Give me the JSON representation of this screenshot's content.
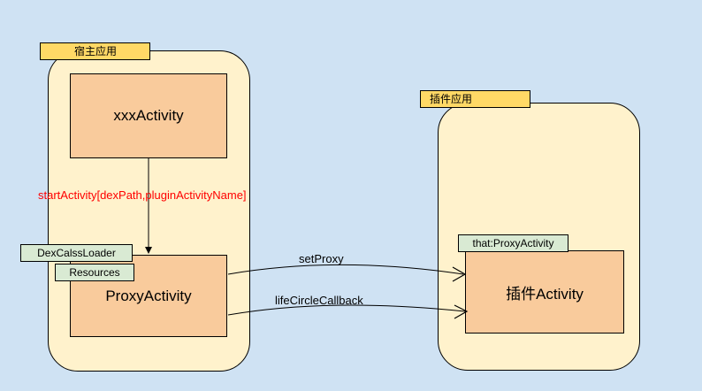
{
  "host": {
    "tag": "宿主应用",
    "top_activity": "xxxActivity",
    "proxy_activity": "ProxyActivity",
    "chips": [
      "DexCalssLoader",
      "Resources"
    ]
  },
  "plugin": {
    "tag": "插件应用",
    "activity": "插件Activity",
    "chip": "that:ProxyActivity"
  },
  "edges": {
    "start_activity": "startActivity[dexPath,pluginActivityName]",
    "set_proxy": "setProxy",
    "life_circle": "lifeCircleCallback"
  },
  "colors": {
    "background": "#cfe2f3",
    "container": "#fff2cc",
    "tag": "#ffd966",
    "activity": "#f9cb9c",
    "chip": "#d9ead3",
    "red_label": "#ff0000"
  }
}
